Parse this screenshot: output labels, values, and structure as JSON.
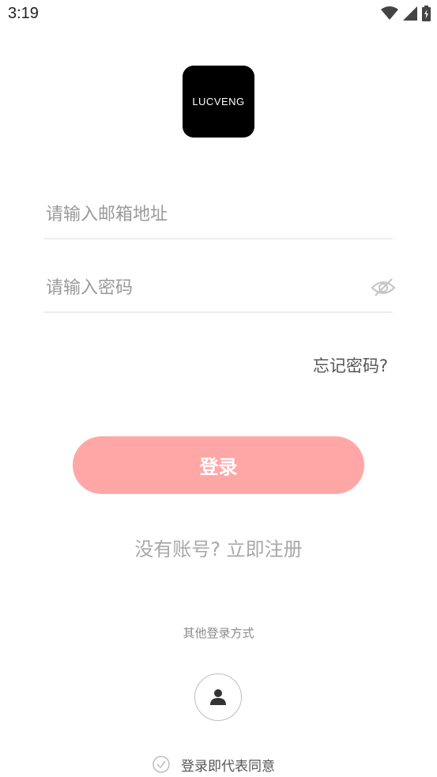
{
  "status_bar": {
    "time": "3:19",
    "icons": [
      "wifi-icon",
      "signal-icon",
      "battery-charging-icon"
    ]
  },
  "logo": {
    "text": "LUCVENG"
  },
  "email": {
    "placeholder": "请输入邮箱地址",
    "value": ""
  },
  "password": {
    "placeholder": "请输入密码",
    "value": "",
    "visibility_icon": "eye-off-icon"
  },
  "forgot_password_label": "忘记密码?",
  "login_button_label": "登录",
  "register_link_label": "没有账号? 立即注册",
  "other_login_label": "其他登录方式",
  "guest_login_icon": "person-icon",
  "agreement": {
    "label": "登录即代表同意",
    "checked": false
  },
  "colors": {
    "accent": "#ffa7a7",
    "logo_bg": "#000000",
    "divider": "#eeeeee",
    "placeholder": "#9a9a9a"
  }
}
